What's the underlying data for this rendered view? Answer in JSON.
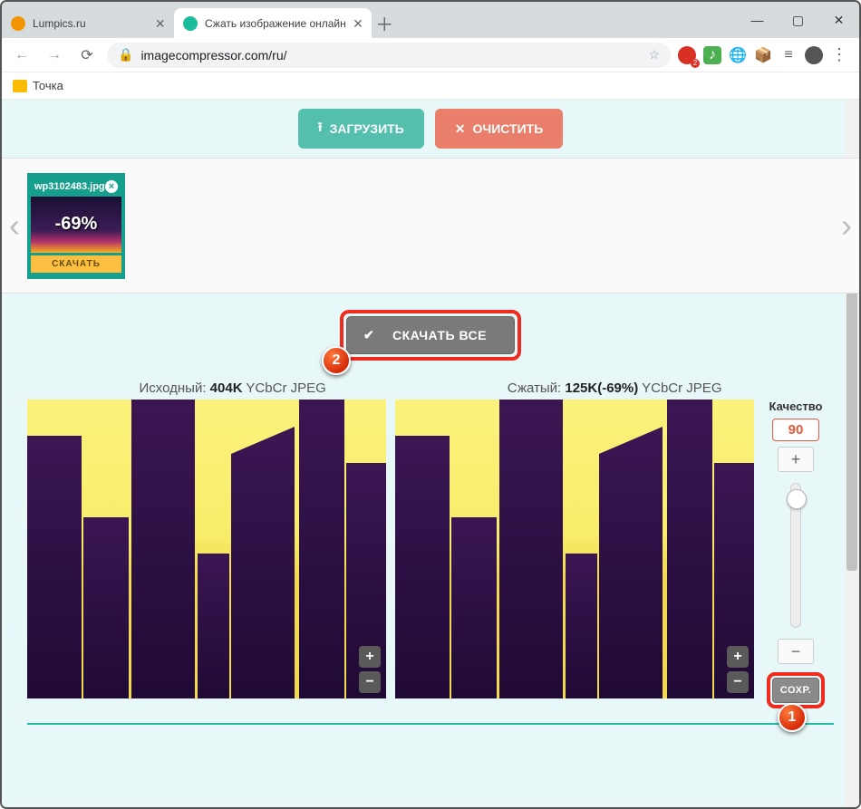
{
  "window": {
    "minimize": "—",
    "maximize": "▢",
    "close": "✕"
  },
  "tabs": [
    {
      "title": "Lumpics.ru",
      "favicon": "orange",
      "active": false
    },
    {
      "title": "Сжать изображение онлайн",
      "favicon": "teal",
      "active": true
    }
  ],
  "nav": {
    "newtab": "＋"
  },
  "address": {
    "url": "imagecompressor.com/ru/",
    "lock": "🔒",
    "star": "☆"
  },
  "extensions": {
    "adblock_badge": "2",
    "music": "♪",
    "globe": "🌐",
    "cube": "📦",
    "playlist": "≡",
    "avatar": "●",
    "menu": "⋮"
  },
  "bookmarks": {
    "folder": "Точка"
  },
  "top_buttons": {
    "upload": "ЗАГРУЗИТЬ",
    "clear": "ОЧИСТИТЬ"
  },
  "thumbnail": {
    "filename": "wp3102483.jpg",
    "percent": "-69%",
    "download": "СКАЧАТЬ"
  },
  "download_all": "СКАЧАТЬ ВСЕ",
  "compare": {
    "left_label_prefix": "Исходный: ",
    "left_size": "404K",
    "left_format": " YCbCr JPEG",
    "right_label_prefix": "Сжатый: ",
    "right_size": "125K(-69%)",
    "right_format": " YCbCr JPEG"
  },
  "quality": {
    "title": "Качество",
    "value": "90",
    "plus": "+",
    "minus": "−",
    "save": "СОХР."
  },
  "markers": {
    "one": "1",
    "two": "2"
  },
  "zoom": {
    "in": "+",
    "out": "−"
  }
}
